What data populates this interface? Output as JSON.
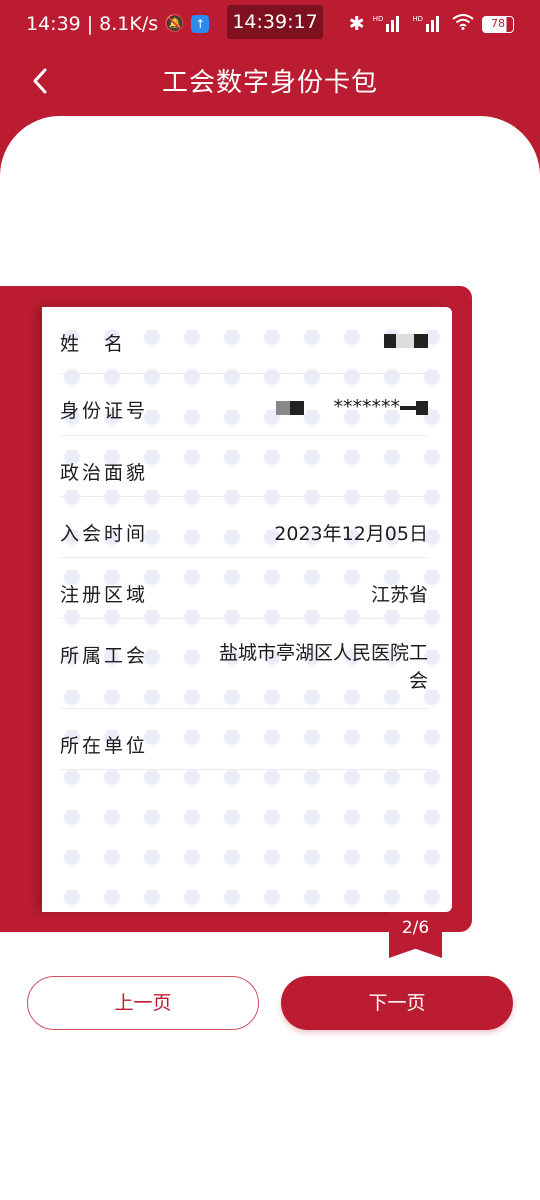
{
  "status_bar": {
    "time": "14:39",
    "speed": "8.1K/s",
    "clock": "14:39:17",
    "battery": "78"
  },
  "nav": {
    "title": "工会数字身份卡包"
  },
  "card": {
    "rows": [
      {
        "label": "姓　名",
        "value": ""
      },
      {
        "label": "身份证号",
        "value": "*******"
      },
      {
        "label": "政治面貌",
        "value": ""
      },
      {
        "label": "入会时间",
        "value": "2023年12月05日"
      },
      {
        "label": "注册区域",
        "value": "江苏省"
      },
      {
        "label": "所属工会",
        "value": "盐城市亭湖区人民医院工会"
      },
      {
        "label": "所在单位",
        "value": ""
      }
    ],
    "page_indicator": "2/6"
  },
  "buttons": {
    "prev": "上一页",
    "next": "下一页"
  },
  "colors": {
    "brand_red": "#BC1C31",
    "clock_bg": "#7E1020"
  }
}
